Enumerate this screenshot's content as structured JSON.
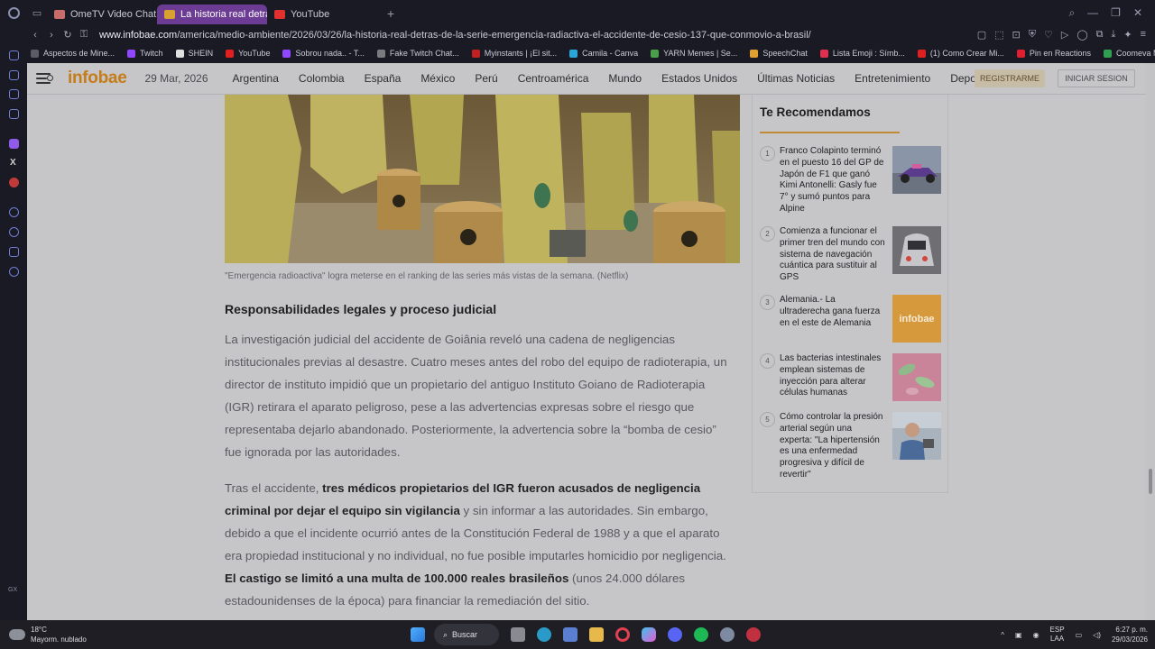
{
  "tabs": [
    {
      "label": "OmeTV Video Chat — ",
      "active": false,
      "icon_color": "#c86b6b"
    },
    {
      "label": "La historia real detrás de",
      "active": true,
      "icon_color": "#d8a030"
    },
    {
      "label": "YouTube",
      "active": false,
      "icon_color": "#e03030"
    }
  ],
  "url": {
    "domain": "www.infobae.com",
    "path": "/america/medio-ambiente/2026/03/26/la-historia-real-detras-de-la-serie-emergencia-radiactiva-el-accidente-de-cesio-137-que-conmovio-a-brasil/"
  },
  "bookmarks": [
    {
      "label": "Aspectos de Mine...",
      "color": "#5c5c66"
    },
    {
      "label": "Twitch",
      "color": "#9146ff"
    },
    {
      "label": "SHEIN",
      "color": "#e0e0e0",
      "glyph": "S"
    },
    {
      "label": "YouTube",
      "color": "#e02020"
    },
    {
      "label": "Sobrou nada.. - T...",
      "color": "#9146ff"
    },
    {
      "label": "Fake Twitch Chat...",
      "color": "#7a7a80"
    },
    {
      "label": "Myinstants | ¡El sit...",
      "color": "#c02020"
    },
    {
      "label": "Camila - Canva",
      "color": "#2aa7d8"
    },
    {
      "label": "YARN Memes | Se...",
      "color": "#4aa04a"
    },
    {
      "label": "SpeechChat",
      "color": "#e0a030"
    },
    {
      "label": "Lista Emoji : Símb...",
      "color": "#e03050"
    },
    {
      "label": "(1) Como Crear Mi...",
      "color": "#e02020"
    },
    {
      "label": "Pin en Reactions",
      "color": "#e02030"
    },
    {
      "label": "Coomeva Medicin...",
      "color": "#30a050"
    }
  ],
  "site": {
    "logo": "infobae",
    "date": "29 Mar, 2026",
    "nav": [
      "Argentina",
      "Colombia",
      "España",
      "México",
      "Perú",
      "Centroamérica",
      "Mundo",
      "Estados Unidos",
      "Últimas Noticias",
      "Entretenimiento",
      "Deportes"
    ],
    "register": "REGISTRARME",
    "login": "INICIAR SESION"
  },
  "article": {
    "caption": "\"Emergencia radioactiva\" logra meterse en el ranking de las series más vistas de la semana. (Netflix)",
    "subheading": "Responsabilidades legales y proceso judicial",
    "p1": "La investigación judicial del accidente de Goiânia reveló una cadena de negligencias institucionales previas al desastre. Cuatro meses antes del robo del equipo de radioterapia, un director de instituto impidió que un propietario del antiguo Instituto Goiano de Radioterapia (IGR) retirara el aparato peligroso, pese a las advertencias expresas sobre el riesgo que representaba dejarlo abandonado. Posteriormente, la advertencia sobre la “bomba de cesio” fue ignorada por las autoridades.",
    "p2": {
      "a": "Tras el accidente, ",
      "b": "tres médicos propietarios del IGR fueron acusados de negligencia criminal por dejar el equipo sin vigilancia",
      "c": " y sin informar a las autoridades. Sin embargo, debido a que el incidente ocurrió antes de la Constitución Federal de 1988 y a que el aparato era propiedad institucional y no individual, no fue posible imputarles homicidio por negligencia. ",
      "d": "El castigo se limitó a una multa de 100.000 reales brasileños",
      "e": " (unos 24.000 dólares estadounidenses de la época) para financiar la remediación del sitio."
    }
  },
  "recommended": {
    "title": "Te Recomendamos",
    "items": [
      {
        "num": "1",
        "text": "Franco Colapinto terminó en el puesto 16 del GP de Japón de F1 que ganó Kimi Antonelli: Gasly fue 7° y sumó puntos para Alpine",
        "thumb": "f1-car"
      },
      {
        "num": "2",
        "text": "Comienza a funcionar el primer tren del mundo con sistema de navegación cuántica para sustituir al GPS",
        "thumb": "train"
      },
      {
        "num": "3",
        "text": "Alemania.- La ultraderecha gana fuerza en el este de Alemania",
        "thumb": "infobae-logo",
        "thumb_label": "infobae"
      },
      {
        "num": "4",
        "text": "Las bacterias intestinales emplean sistemas de inyección para alterar células humanas",
        "thumb": "bacteria"
      },
      {
        "num": "5",
        "text": "Cómo controlar la presión arterial según una experta: \"La hipertensión es una enfermedad progresiva y difícil de revertir\"",
        "thumb": "doctor"
      }
    ]
  },
  "taskbar": {
    "temp": "18°C",
    "weather": "Mayorm. nublado",
    "search": "Buscar",
    "lang1": "ESP",
    "lang2": "LAA",
    "time": "6:27 p. m.",
    "date": "29/03/2026"
  },
  "sidebar_label": "GX",
  "colors": {
    "accent": "#c57c1a",
    "tab_active": "#6c3c95",
    "chrome": "#1a1a24"
  }
}
